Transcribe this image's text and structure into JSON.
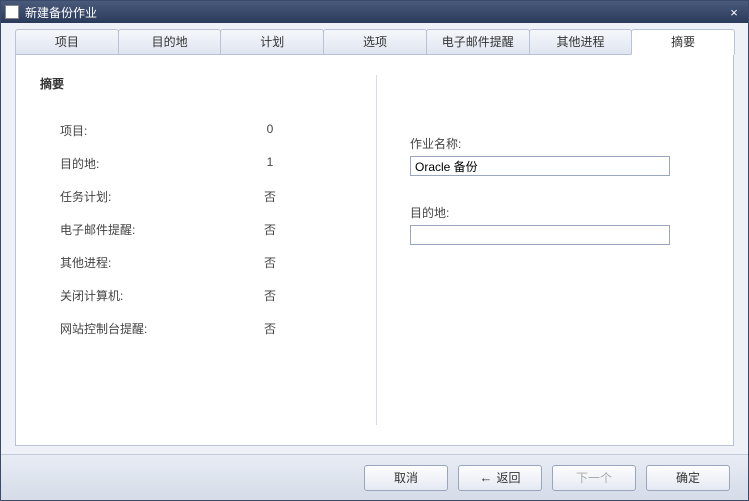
{
  "window": {
    "title": "新建备份作业",
    "close_glyph": "×"
  },
  "tabs": [
    {
      "label": "项目"
    },
    {
      "label": "目的地"
    },
    {
      "label": "计划"
    },
    {
      "label": "选项"
    },
    {
      "label": "电子邮件提醒"
    },
    {
      "label": "其他进程"
    },
    {
      "label": "摘要"
    }
  ],
  "summary": {
    "heading": "摘要",
    "rows": [
      {
        "label": "项目:",
        "value": "0"
      },
      {
        "label": "目的地:",
        "value": "1"
      },
      {
        "label": "任务计划:",
        "value": "否"
      },
      {
        "label": "电子邮件提醒:",
        "value": "否"
      },
      {
        "label": "其他进程:",
        "value": "否"
      },
      {
        "label": "关闭计算机:",
        "value": "否"
      },
      {
        "label": "网站控制台提醒:",
        "value": "否"
      }
    ]
  },
  "form": {
    "job_name_label": "作业名称:",
    "job_name_value": "Oracle 备份",
    "destination_label": "目的地:",
    "destination_value": ""
  },
  "buttons": {
    "cancel": "取消",
    "back_arrow": "←",
    "back": "返回",
    "next": "下一个",
    "ok": "确定"
  }
}
